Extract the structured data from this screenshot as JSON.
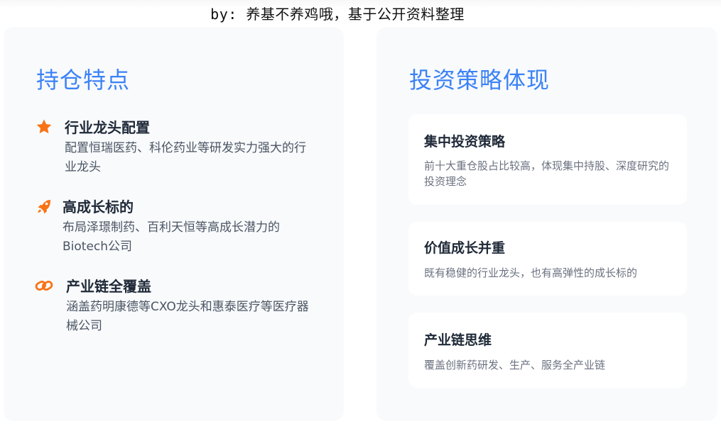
{
  "byline": "by: 养基不养鸡哦，基于公开资料整理",
  "colors": {
    "accent": "#3b82f6",
    "icon_orange": "#f97316"
  },
  "left_panel": {
    "title": "持仓特点",
    "features": [
      {
        "icon": "star-icon",
        "title": "行业龙头配置",
        "desc": "配置恒瑞医药、科伦药业等研发实力强大的行业龙头"
      },
      {
        "icon": "rocket-icon",
        "title": "高成长标的",
        "desc": "布局泽璟制药、百利天恒等高成长潜力的Biotech公司"
      },
      {
        "icon": "link-icon",
        "title": "产业链全覆盖",
        "desc": "涵盖药明康德等CXO龙头和惠泰医疗等医疗器械公司"
      }
    ]
  },
  "right_panel": {
    "title": "投资策略体现",
    "cards": [
      {
        "title": "集中投资策略",
        "desc": "前十大重仓股占比较高，体现集中持股、深度研究的投资理念"
      },
      {
        "title": "价值成长并重",
        "desc": "既有稳健的行业龙头，也有高弹性的成长标的"
      },
      {
        "title": "产业链思维",
        "desc": "覆盖创新药研发、生产、服务全产业链"
      }
    ]
  }
}
